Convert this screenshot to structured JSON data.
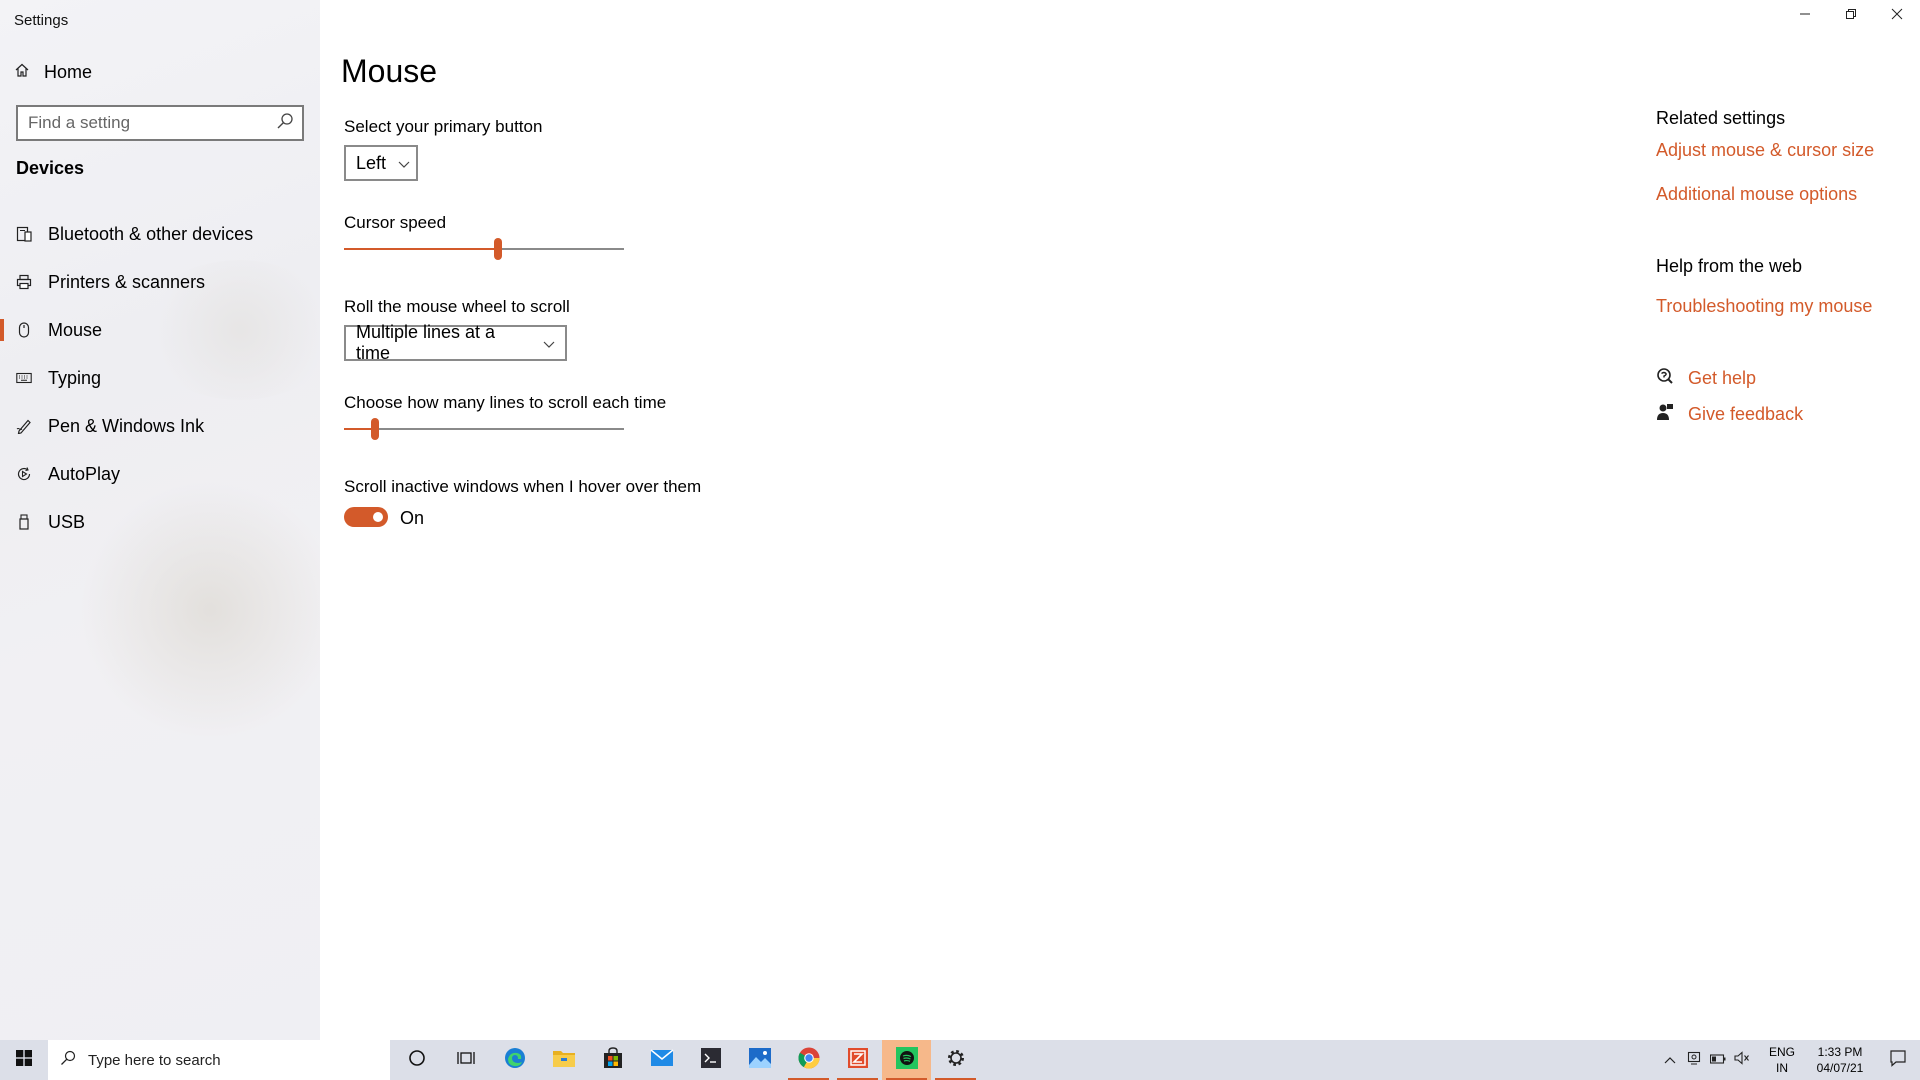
{
  "window": {
    "title": "Settings",
    "controls": {
      "minimize": "minimize-icon",
      "restore": "restore-icon",
      "close": "close-icon"
    }
  },
  "sidebar": {
    "home_label": "Home",
    "search_placeholder": "Find a setting",
    "section_title": "Devices",
    "items": [
      {
        "label": "Bluetooth & other devices",
        "icon": "bluetooth-devices-icon",
        "active": false
      },
      {
        "label": "Printers & scanners",
        "icon": "printer-icon",
        "active": false
      },
      {
        "label": "Mouse",
        "icon": "mouse-icon",
        "active": true
      },
      {
        "label": "Typing",
        "icon": "keyboard-icon",
        "active": false
      },
      {
        "label": "Pen & Windows Ink",
        "icon": "pen-icon",
        "active": false
      },
      {
        "label": "AutoPlay",
        "icon": "autoplay-icon",
        "active": false
      },
      {
        "label": "USB",
        "icon": "usb-icon",
        "active": false
      }
    ]
  },
  "main": {
    "title": "Mouse",
    "primary_button": {
      "label": "Select your primary button",
      "value": "Left"
    },
    "cursor_speed": {
      "label": "Cursor speed",
      "value_fraction": 0.55
    },
    "wheel_scroll": {
      "label": "Roll the mouse wheel to scroll",
      "value": "Multiple lines at a time"
    },
    "lines_to_scroll": {
      "label": "Choose how many lines to scroll each time",
      "value_fraction": 0.11
    },
    "scroll_inactive": {
      "label": "Scroll inactive windows when I hover over them",
      "state": "On"
    }
  },
  "related": {
    "related_heading": "Related settings",
    "link_cursor_size": "Adjust mouse & cursor size",
    "link_additional": "Additional mouse options",
    "web_heading": "Help from the web",
    "link_troubleshoot": "Troubleshooting my mouse",
    "get_help": "Get help",
    "give_feedback": "Give feedback"
  },
  "taskbar": {
    "search_placeholder": "Type here to search",
    "apps": [
      "cortana-icon",
      "task-view-icon",
      "edge-icon",
      "file-explorer-icon",
      "store-icon",
      "mail-icon",
      "terminal-icon",
      "photos-icon",
      "chrome-icon",
      "zoho-icon",
      "spotify-icon",
      "settings-icon"
    ],
    "language": {
      "line1": "ENG",
      "line2": "IN"
    },
    "clock": {
      "time": "1:33 PM",
      "date": "04/07/21"
    }
  },
  "colors": {
    "accent": "#d35a2a",
    "taskbar": "#dcdfe8"
  }
}
